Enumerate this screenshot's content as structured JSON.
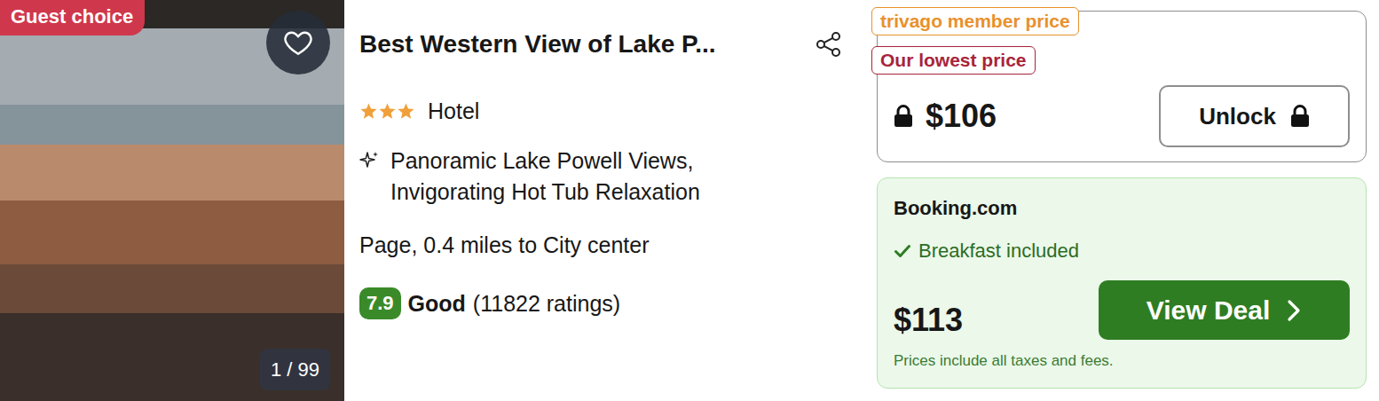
{
  "photo": {
    "badge": "Guest choice",
    "counter": "1 / 99",
    "favorite": false
  },
  "hotel": {
    "name": "Best Western View of Lake P...",
    "stars": 3,
    "type": "Hotel",
    "highlights": [
      "Panoramic Lake Powell Views,",
      "Invigorating Hot Tub Relaxation"
    ],
    "location": "Page, 0.4 miles to City center",
    "rating": {
      "score": "7.9",
      "label": "Good",
      "count": "(11822 ratings)"
    }
  },
  "member_offer": {
    "tags": [
      {
        "label": "trivago member price",
        "color": "#e8912d"
      },
      {
        "label": "Our lowest price",
        "color": "#a8243b"
      }
    ],
    "price": "$106",
    "locked": true,
    "button": "Unlock"
  },
  "deal": {
    "provider": "Booking.com",
    "perk": "Breakfast included",
    "price": "$113",
    "button": "View Deal",
    "note": "Prices include all taxes and fees."
  }
}
